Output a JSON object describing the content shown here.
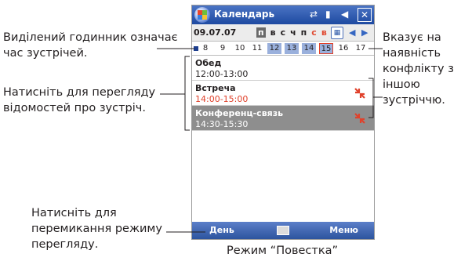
{
  "callouts": {
    "highlighted_hour": "Виділений годинник означає час зустрічей.",
    "tap_details": "Натисніть для перегляду відомостей про зустріч.",
    "conflict": "Вказує на наявність конфлікту з іншою зустріччю.",
    "switch_mode": "Натисніть для перемикання режиму перегляду."
  },
  "caption": "Режим “Повестка”",
  "device": {
    "app_title": "Календарь",
    "date": "09.07.07",
    "weekdays": [
      "п",
      "в",
      "с",
      "ч",
      "п",
      "с",
      "в"
    ],
    "hours": [
      "8",
      "9",
      "10",
      "11",
      "12",
      "13",
      "14",
      "15",
      "16",
      "17"
    ],
    "busy_hours": [
      "12",
      "13",
      "14"
    ],
    "conflict_hour": "15",
    "appointments": [
      {
        "title": "Обед",
        "time": "12:00-13:00",
        "conflict": false
      },
      {
        "title": "Встреча",
        "time": "14:00-15:00",
        "conflict": true
      },
      {
        "title": "Конференц-связь",
        "time": "14:30-15:30",
        "conflict": true
      }
    ],
    "softkey_left": "День",
    "softkey_right": "Меню"
  },
  "colors": {
    "titlebar": "#2d5fb8",
    "busy_hour": "#9ab0dc",
    "conflict": "#e0412b",
    "selected_appt": "#8e8e8e"
  },
  "icons": [
    "windows-start-icon",
    "sync-icon",
    "signal-icon",
    "volume-icon",
    "close-icon",
    "today-icon",
    "prev-arrow-icon",
    "next-arrow-icon",
    "conflict-icon",
    "keyboard-icon"
  ]
}
